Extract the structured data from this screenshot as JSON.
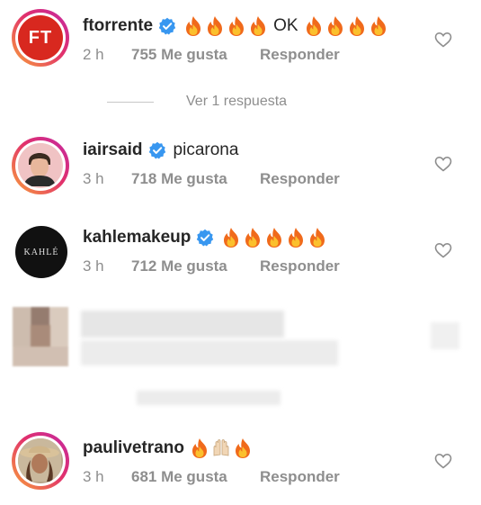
{
  "comments": [
    {
      "username": "ftorrente",
      "verified": true,
      "text_before": "",
      "text_after": "OK",
      "avatar_label": "FT",
      "time": "2 h",
      "likes": "755 Me gusta",
      "reply": "Responder"
    },
    {
      "username": "iairsaid",
      "verified": true,
      "text": "picarona",
      "time": "3 h",
      "likes": "718 Me gusta",
      "reply": "Responder"
    },
    {
      "username": "kahlemakeup",
      "verified": true,
      "avatar_label": "KAHLÉ",
      "time": "3 h",
      "likes": "712 Me gusta",
      "reply": "Responder"
    },
    {
      "username": "paulivetrano",
      "verified": false,
      "time": "3 h",
      "likes": "681 Me gusta",
      "reply": "Responder"
    }
  ],
  "view_replies": "Ver 1 respuesta",
  "colors": {
    "verified": "#3897f0",
    "muted": "#8e8e8e",
    "ft_red": "#d8281f",
    "ring_start": "#f9a23a",
    "ring_end": "#c32aa3"
  }
}
